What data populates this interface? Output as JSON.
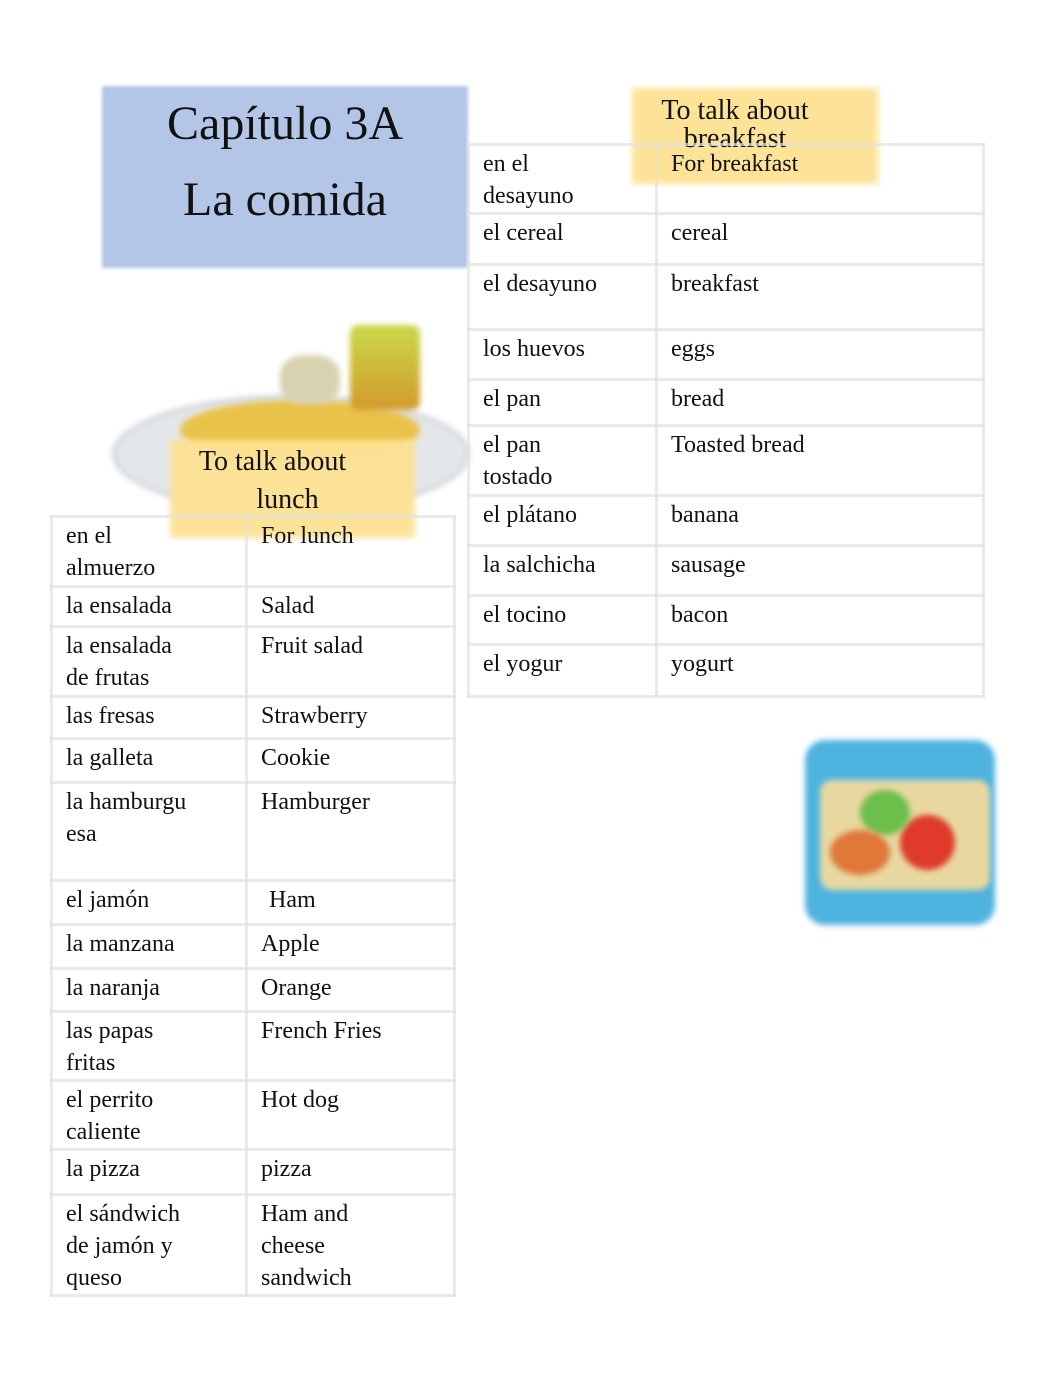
{
  "title": {
    "line1": "Capítulo 3A",
    "line2": "La comida"
  },
  "colors": {
    "title_bg": "#b3c6e7",
    "label_bg": "#fde293"
  },
  "images": {
    "breakfast": "breakfast-plate-illustration",
    "lunch": "lunchbox-illustration"
  },
  "breakfast": {
    "label": [
      "To talk about",
      "breakfast"
    ],
    "rows": [
      {
        "es": "en el desayuno",
        "en": "For breakfast"
      },
      {
        "es": "el cereal",
        "en": "cereal"
      },
      {
        "es": "el desayuno",
        "en": "breakfast"
      },
      {
        "es": "los huevos",
        "en": "eggs"
      },
      {
        "es": "el pan",
        "en": "bread"
      },
      {
        "es": "el pan tostado",
        "en": "Toasted bread"
      },
      {
        "es": "el plátano",
        "en": "banana"
      },
      {
        "es": "la salchicha",
        "en": "sausage"
      },
      {
        "es": "el tocino",
        "en": "bacon"
      },
      {
        "es": "el yogur",
        "en": "yogurt"
      }
    ]
  },
  "lunch": {
    "label": [
      "To talk about",
      "lunch"
    ],
    "rows": [
      {
        "es": "en el almuerzo",
        "en": "For lunch"
      },
      {
        "es": "la ensalada",
        "en": "Salad"
      },
      {
        "es": "la ensalada de frutas",
        "en": "Fruit salad"
      },
      {
        "es": "las fresas",
        "en": "Strawberry"
      },
      {
        "es": "la galleta",
        "en": "Cookie"
      },
      {
        "es": "la hamburguesa",
        "en": "Hamburger"
      },
      {
        "es": "el jamón",
        "en": "Ham"
      },
      {
        "es": "la manzana",
        "en": "Apple"
      },
      {
        "es": "la naranja",
        "en": "Orange"
      },
      {
        "es": "las papas fritas",
        "en": "French Fries"
      },
      {
        "es": "el perrito caliente",
        "en": "Hot dog"
      },
      {
        "es": "la pizza",
        "en": "pizza"
      },
      {
        "es": "el sándwich de jamón y queso",
        "en": "Ham and cheese sandwich"
      }
    ]
  }
}
